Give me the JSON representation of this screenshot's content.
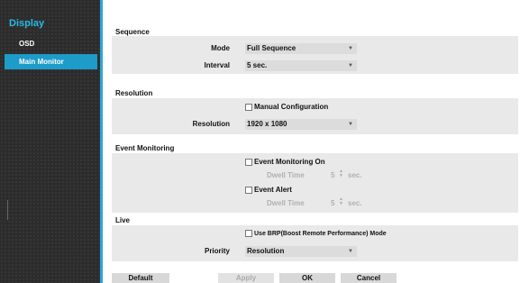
{
  "sidebar": {
    "title": "Display",
    "items": [
      {
        "label": "OSD"
      },
      {
        "label": "Main Monitor"
      }
    ]
  },
  "sequence": {
    "title": "Sequence",
    "mode_label": "Mode",
    "mode_value": "Full Sequence",
    "interval_label": "Interval",
    "interval_value": "5 sec."
  },
  "resolution": {
    "title": "Resolution",
    "manual_label": "Manual Configuration",
    "resolution_label": "Resolution",
    "resolution_value": "1920 x 1080"
  },
  "event_monitoring": {
    "title": "Event Monitoring",
    "monitoring_on_label": "Event Monitoring On",
    "dwell_label_1": "Dwell Time",
    "dwell_value_1": "5",
    "dwell_unit_1": "sec.",
    "event_alert_label": "Event Alert",
    "dwell_label_2": "Dwell Time",
    "dwell_value_2": "5",
    "dwell_unit_2": "sec."
  },
  "live": {
    "title": "Live",
    "brp_label": "Use BRP(Boost Remote Performance) Mode",
    "priority_label": "Priority",
    "priority_value": "Resolution"
  },
  "buttons": {
    "default": "Default",
    "apply": "Apply",
    "ok": "OK",
    "cancel": "Cancel"
  }
}
